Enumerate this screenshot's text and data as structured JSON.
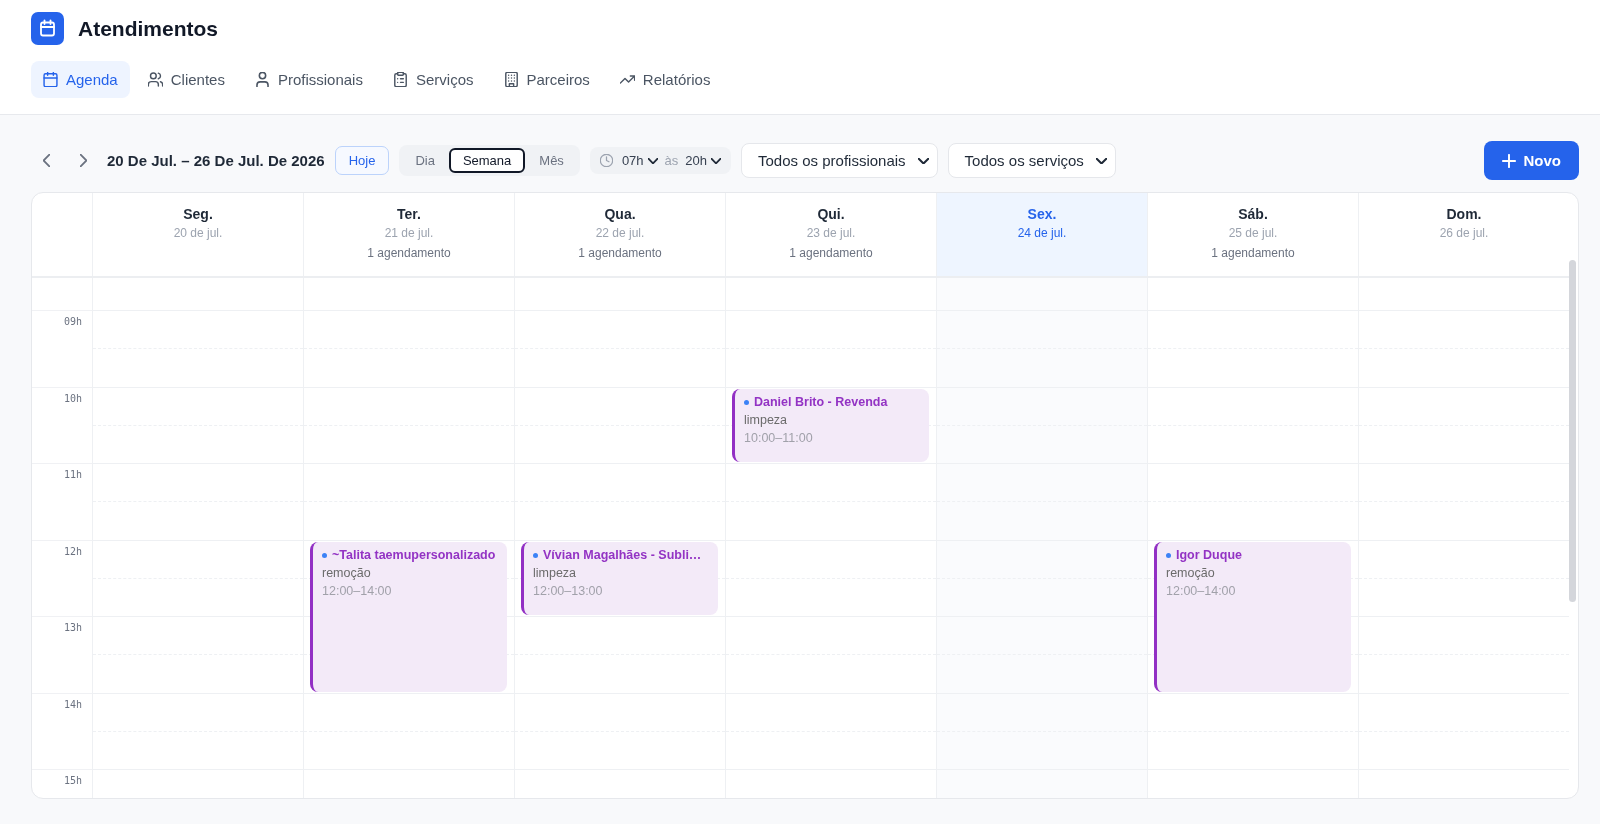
{
  "app": {
    "title": "Atendimentos"
  },
  "tabs": [
    {
      "kind": "agenda",
      "label": "Agenda",
      "selected": true
    },
    {
      "kind": "clients",
      "label": "Clientes",
      "selected": false
    },
    {
      "kind": "professionals",
      "label": "Profissionais",
      "selected": false
    },
    {
      "kind": "services",
      "label": "Serviços",
      "selected": false
    },
    {
      "kind": "partners",
      "label": "Parceiros",
      "selected": false
    },
    {
      "kind": "reports",
      "label": "Relatórios",
      "selected": false
    }
  ],
  "toolbar": {
    "date_range": "20 De Jul. – 26 De Jul. De 2026",
    "today_button": "Hoje",
    "views": [
      {
        "label": "Dia",
        "selected": false
      },
      {
        "label": "Semana",
        "selected": true
      },
      {
        "label": "Mês",
        "selected": false
      }
    ],
    "time_range": {
      "from": "07h",
      "separator": "às",
      "to": "20h"
    },
    "filters": [
      {
        "value": "Todos os profissionais"
      },
      {
        "value": "Todos os serviços"
      }
    ],
    "new_button": "Novo"
  },
  "calendar": {
    "hours": [
      "09h",
      "10h",
      "11h",
      "12h",
      "13h",
      "14h",
      "15h"
    ],
    "days": [
      {
        "name": "Seg.",
        "date": "20 de jul.",
        "today": false
      },
      {
        "name": "Ter.",
        "date": "21 de jul.",
        "count": "1 agendamento",
        "today": false,
        "events": [
          {
            "title": "~Talita taemupersonalizado",
            "service": "remoção",
            "time": "12:00–14:00"
          }
        ]
      },
      {
        "name": "Qua.",
        "date": "22 de jul.",
        "count": "1 agendamento",
        "today": false,
        "events": [
          {
            "title": "Vívian Magalhães - Subli…",
            "service": "limpeza",
            "time": "12:00–13:00"
          }
        ]
      },
      {
        "name": "Qui.",
        "date": "23 de jul.",
        "count": "1 agendamento",
        "today": false,
        "events": [
          {
            "title": "Daniel Brito - Revenda",
            "service": "limpeza",
            "time": "10:00–11:00"
          }
        ]
      },
      {
        "name": "Sex.",
        "date": "24 de jul.",
        "today": true
      },
      {
        "name": "Sáb.",
        "date": "25 de jul.",
        "count": "1 agendamento",
        "today": false,
        "events": [
          {
            "title": "Igor Duque",
            "service": "remoção",
            "time": "12:00–14:00"
          }
        ]
      },
      {
        "name": "Dom.",
        "date": "26 de jul.",
        "today": false
      }
    ]
  }
}
